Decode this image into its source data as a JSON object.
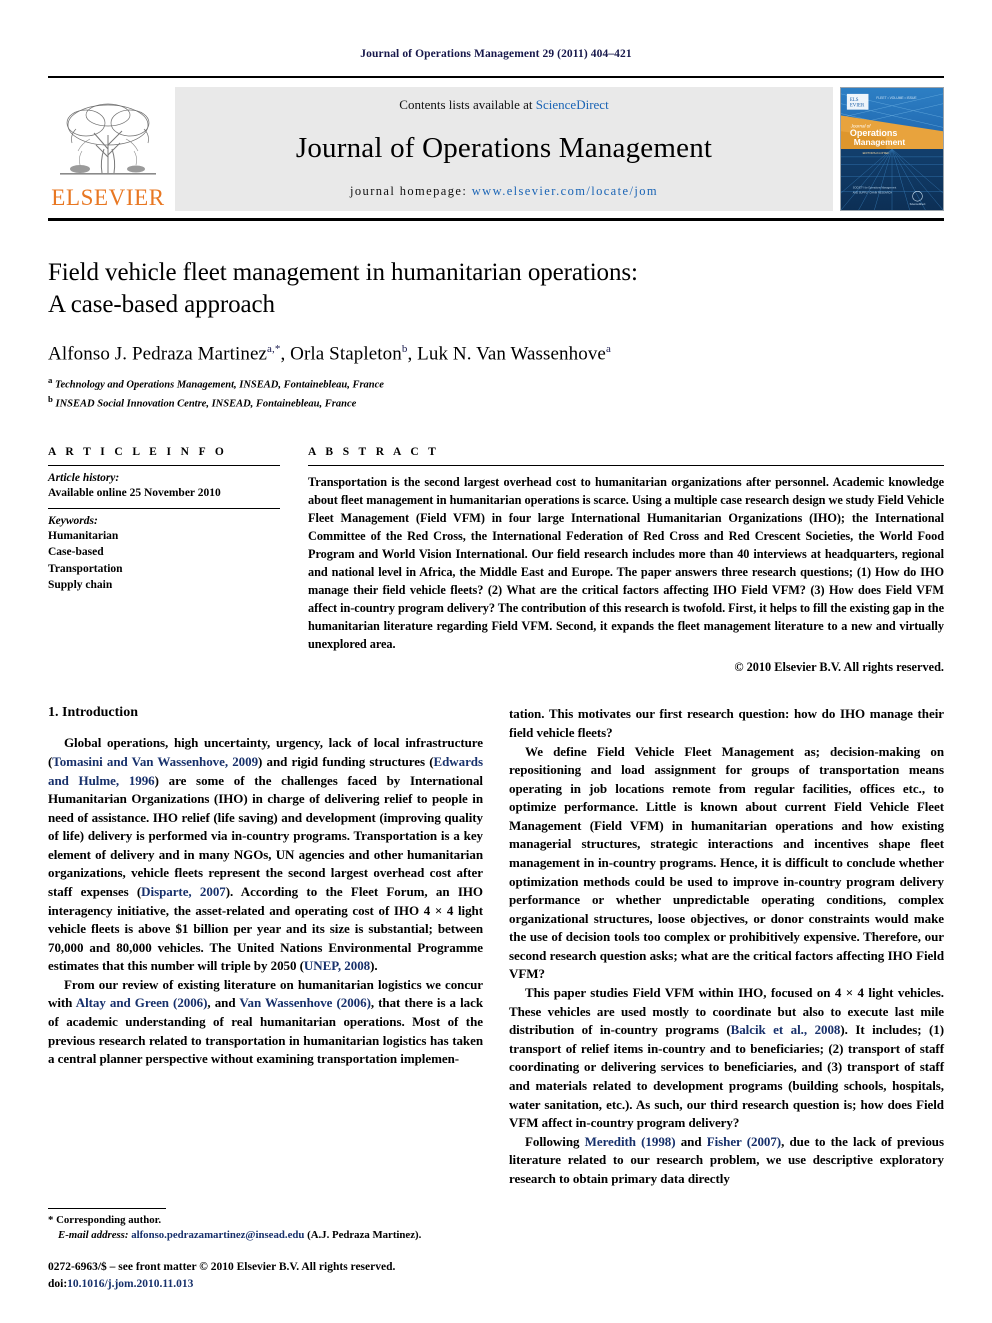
{
  "running_head": "Journal of Operations Management 29 (2011) 404–421",
  "masthead": {
    "contents_prefix": "Contents lists available at ",
    "sciencedirect": "ScienceDirect",
    "journal_name": "Journal of Operations Management",
    "homepage_prefix": "journal homepage: ",
    "homepage_url": "www.elsevier.com/locate/jom",
    "publisher": "ELSEVIER",
    "cover": {
      "line1": "Journal of",
      "line2": "Operations",
      "line3": "Management"
    },
    "colors": {
      "link_blue": "#1a64b5",
      "elsevier_orange": "#e87722",
      "band_grey": "#e9e9e9",
      "cover_blue": "#1b5fa8",
      "cover_orange": "#e8a33d"
    }
  },
  "article": {
    "title_line1": "Field vehicle fleet management in humanitarian operations:",
    "title_line2": "A case-based approach",
    "authors_raw": "Alfonso J. Pedraza Martinez a,*, Orla Stapleton b, Luk N. Van Wassenhove a",
    "author_list": [
      {
        "name": "Alfonso J. Pedraza Martinez",
        "marks": "a,*"
      },
      {
        "name": "Orla Stapleton",
        "marks": "b"
      },
      {
        "name": "Luk N. Van Wassenhove",
        "marks": "a"
      }
    ],
    "affiliations": [
      {
        "mark": "a",
        "text": "Technology and Operations Management, INSEAD, Fontainebleau, France"
      },
      {
        "mark": "b",
        "text": "INSEAD Social Innovation Centre, INSEAD, Fontainebleau, France"
      }
    ]
  },
  "article_info": {
    "label": "A R T I C L E   I N F O",
    "history_head": "Article history:",
    "history_line": "Available online 25 November 2010",
    "keywords_head": "Keywords:",
    "keywords": [
      "Humanitarian",
      "Case-based",
      "Transportation",
      "Supply chain"
    ]
  },
  "abstract": {
    "label": "A B S T R A C T",
    "text": "Transportation is the second largest overhead cost to humanitarian organizations after personnel. Academic knowledge about fleet management in humanitarian operations is scarce. Using a multiple case research design we study Field Vehicle Fleet Management (Field VFM) in four large International Humanitarian Organizations (IHO); the International Committee of the Red Cross, the International Federation of Red Cross and Red Crescent Societies, the World Food Program and World Vision International. Our field research includes more than 40 interviews at headquarters, regional and national level in Africa, the Middle East and Europe. The paper answers three research questions; (1) How do IHO manage their field vehicle fleets? (2) What are the critical factors affecting IHO Field VFM? (3) How does Field VFM affect in-country program delivery? The contribution of this research is twofold. First, it helps to fill the existing gap in the humanitarian literature regarding Field VFM. Second, it expands the fleet management literature to a new and virtually unexplored area.",
    "copyright": "© 2010 Elsevier B.V. All rights reserved."
  },
  "body": {
    "section_number": "1.",
    "section_title": "Introduction",
    "left_paragraphs": [
      {
        "segments": [
          {
            "t": "Global operations, high uncertainty, urgency, lack of local infrastructure (",
            "c": false
          },
          {
            "t": "Tomasini and Van Wassenhove, 2009",
            "c": true
          },
          {
            "t": ") and rigid funding structures (",
            "c": false
          },
          {
            "t": "Edwards and Hulme, 1996",
            "c": true
          },
          {
            "t": ") are some of the challenges faced by International Humanitarian Organizations (IHO) in charge of delivering relief to people in need of assistance. IHO relief (life saving) and development (improving quality of life) delivery is performed via in-country programs. Transportation is a key element of delivery and in many NGOs, UN agencies and other humanitarian organizations, vehicle fleets represent the second largest overhead cost after staff expenses (",
            "c": false
          },
          {
            "t": "Disparte, 2007",
            "c": true
          },
          {
            "t": "). According to the Fleet Forum, an IHO interagency initiative, the asset-related and operating cost of IHO 4 × 4 light vehicle fleets is above $1 billion per year and its size is substantial; between 70,000 and 80,000 vehicles. The United Nations Environmental Programme estimates that this number will triple by 2050 (",
            "c": false
          },
          {
            "t": "UNEP, 2008",
            "c": true
          },
          {
            "t": ").",
            "c": false
          }
        ]
      },
      {
        "segments": [
          {
            "t": "From our review of existing literature on humanitarian logistics we concur with ",
            "c": false
          },
          {
            "t": "Altay and Green (2006)",
            "c": true
          },
          {
            "t": ", and ",
            "c": false
          },
          {
            "t": "Van Wassenhove (2006)",
            "c": true
          },
          {
            "t": ", that there is a lack of academic understanding of real humanitarian operations. Most of the previous research related to transportation in humanitarian logistics has taken a central planner perspective without examining transportation implemen-",
            "c": false
          }
        ]
      }
    ],
    "right_paragraphs": [
      {
        "no_indent": true,
        "segments": [
          {
            "t": "tation. This motivates our first research question: how do IHO manage their field vehicle fleets?",
            "c": false
          }
        ]
      },
      {
        "segments": [
          {
            "t": "We define Field Vehicle Fleet Management as; decision-making on repositioning and load assignment for groups of transportation means operating in job locations remote from regular facilities, offices etc., to optimize performance. Little is known about current Field Vehicle Fleet Management (Field VFM) in humanitarian operations and how existing managerial structures, strategic interactions and incentives shape fleet management in in-country programs. Hence, it is difficult to conclude whether optimization methods could be used to improve in-country program delivery performance or whether unpredictable operating conditions, complex organizational structures, loose objectives, or donor constraints would make the use of decision tools too complex or prohibitively expensive. Therefore, our second research question asks; what are the critical factors affecting IHO Field VFM?",
            "c": false
          }
        ]
      },
      {
        "segments": [
          {
            "t": "This paper studies Field VFM within IHO, focused on 4 × 4 light vehicles. These vehicles are used mostly to coordinate but also to execute last mile distribution of in-country programs (",
            "c": false
          },
          {
            "t": "Balcik et al., 2008",
            "c": true
          },
          {
            "t": "). It includes; (1) transport of relief items in-country and to beneficiaries; (2) transport of staff coordinating or delivering services to beneficiaries, and (3) transport of staff and materials related to development programs (building schools, hospitals, water sanitation, etc.). As such, our third research question is; how does Field VFM affect in-country program delivery?",
            "c": false
          }
        ]
      },
      {
        "segments": [
          {
            "t": "Following ",
            "c": false
          },
          {
            "t": "Meredith (1998)",
            "c": true
          },
          {
            "t": " and ",
            "c": false
          },
          {
            "t": "Fisher (2007)",
            "c": true
          },
          {
            "t": ", due to the lack of previous literature related to our research problem, we use descriptive exploratory research to obtain primary data directly",
            "c": false
          }
        ]
      }
    ]
  },
  "footer": {
    "corresponding": "* Corresponding author.",
    "email_label": "E-mail address:",
    "email": "alfonso.pedrazamartinez@insead.edu",
    "email_suffix": "(A.J. Pedraza Martinez).",
    "issn_line": "0272-6963/$ – see front matter © 2010 Elsevier B.V. All rights reserved.",
    "doi_label": "doi:",
    "doi": "10.1016/j.jom.2010.11.013"
  }
}
